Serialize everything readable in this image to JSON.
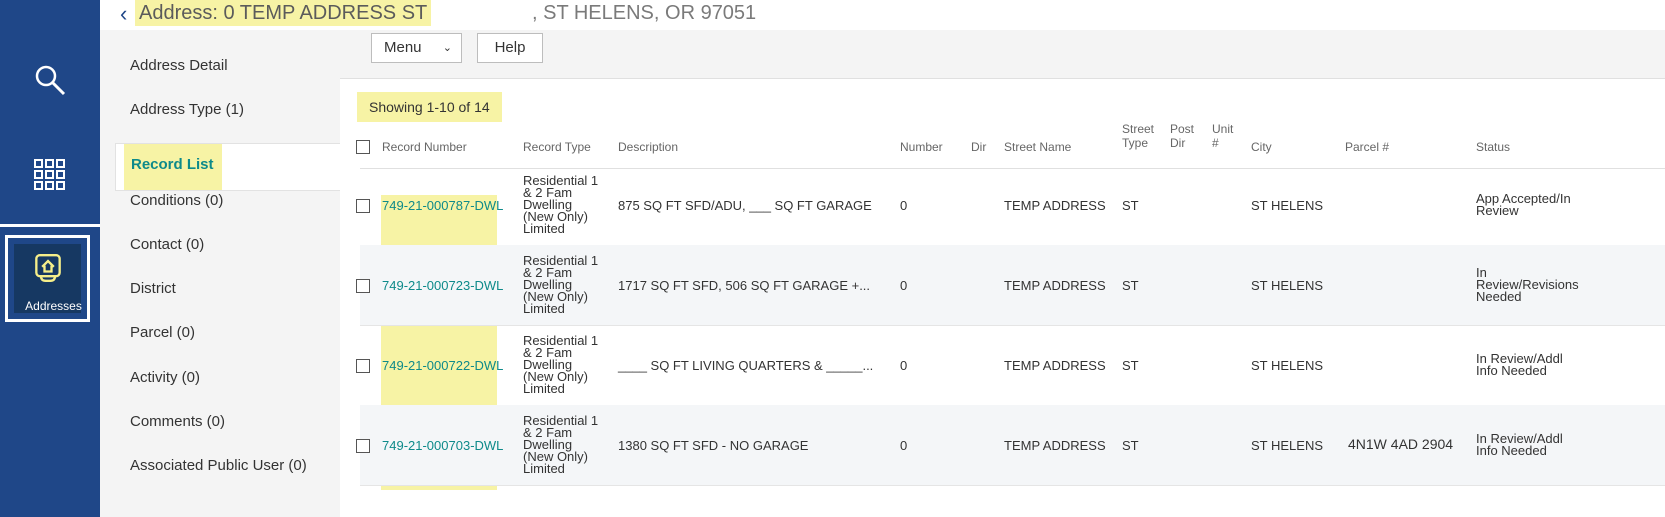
{
  "nav": {
    "addresses_label": "Addresses"
  },
  "header": {
    "address_highlight": "Address: 0 TEMP ADDRESS ST",
    "address_rest": ", ST HELENS, OR 97051"
  },
  "sidebar": {
    "items": [
      {
        "label": "Address Detail"
      },
      {
        "label": "Address Type (1)"
      },
      {
        "label": "Record List"
      },
      {
        "label": "Conditions (0)"
      },
      {
        "label": "Contact (0)"
      },
      {
        "label": "District"
      },
      {
        "label": "Parcel (0)"
      },
      {
        "label": "Activity (0)"
      },
      {
        "label": "Comments (0)"
      },
      {
        "label": "Associated Public User (0)"
      }
    ]
  },
  "toolbar": {
    "menu_label": "Menu",
    "help_label": "Help"
  },
  "showing_text": "Showing 1-10 of 14",
  "table": {
    "headers": {
      "record_number": "Record Number",
      "record_type": "Record Type",
      "description": "Description",
      "number": "Number",
      "dir": "Dir",
      "street_name": "Street Name",
      "street_type_1": "Street",
      "street_type_2": "Type",
      "post_dir_1": "Post",
      "post_dir_2": "Dir",
      "unit_1": "Unit",
      "unit_2": "#",
      "city": "City",
      "parcel": "Parcel #",
      "status": "Status"
    },
    "rows": [
      {
        "record_number": "749-21-000787-DWL",
        "record_type": [
          "Residential 1",
          "& 2 Fam",
          "Dwelling",
          "(New Only)",
          "Limited"
        ],
        "description": "875 SQ FT SFD/ADU, ___ SQ FT GARAGE",
        "number": "0",
        "street_name": "TEMP ADDRESS",
        "street_type": "ST",
        "city": "ST HELENS",
        "parcel": "",
        "status": [
          "App Accepted/In",
          "Review"
        ]
      },
      {
        "record_number": "749-21-000723-DWL",
        "record_type": [
          "Residential 1",
          "& 2 Fam",
          "Dwelling",
          "(New Only)",
          "Limited"
        ],
        "description": "1717 SQ FT SFD, 506 SQ FT GARAGE +...",
        "number": "0",
        "street_name": "TEMP ADDRESS",
        "street_type": "ST",
        "city": "ST HELENS",
        "parcel": "",
        "status": [
          "In",
          "Review/Revisions",
          "Needed"
        ]
      },
      {
        "record_number": "749-21-000722-DWL",
        "record_type": [
          "Residential 1",
          "& 2 Fam",
          "Dwelling",
          "(New Only)",
          "Limited"
        ],
        "description": "____ SQ FT LIVING QUARTERS & _____...",
        "number": "0",
        "street_name": "TEMP ADDRESS",
        "street_type": "ST",
        "city": "ST HELENS",
        "parcel": "",
        "status": [
          "In Review/Addl",
          "Info Needed"
        ]
      },
      {
        "record_number": "749-21-000703-DWL",
        "record_type": [
          "Residential 1",
          "& 2 Fam",
          "Dwelling",
          "(New Only)",
          "Limited"
        ],
        "description": "1380 SQ FT SFD - NO GARAGE",
        "number": "0",
        "street_name": "TEMP ADDRESS",
        "street_type": "ST",
        "city": "ST HELENS",
        "parcel": "4N1W 4AD 2904",
        "status": [
          "In Review/Addl",
          "Info Needed"
        ]
      }
    ]
  },
  "colors": {
    "nav_blue": "#1f4788",
    "highlight_yellow": "#f7f3a5",
    "link_teal": "#0e8a8a"
  },
  "icons": [
    "search-icon",
    "apps-grid-icon",
    "address-house-icon",
    "chevron-left-icon",
    "chevron-down-icon"
  ]
}
